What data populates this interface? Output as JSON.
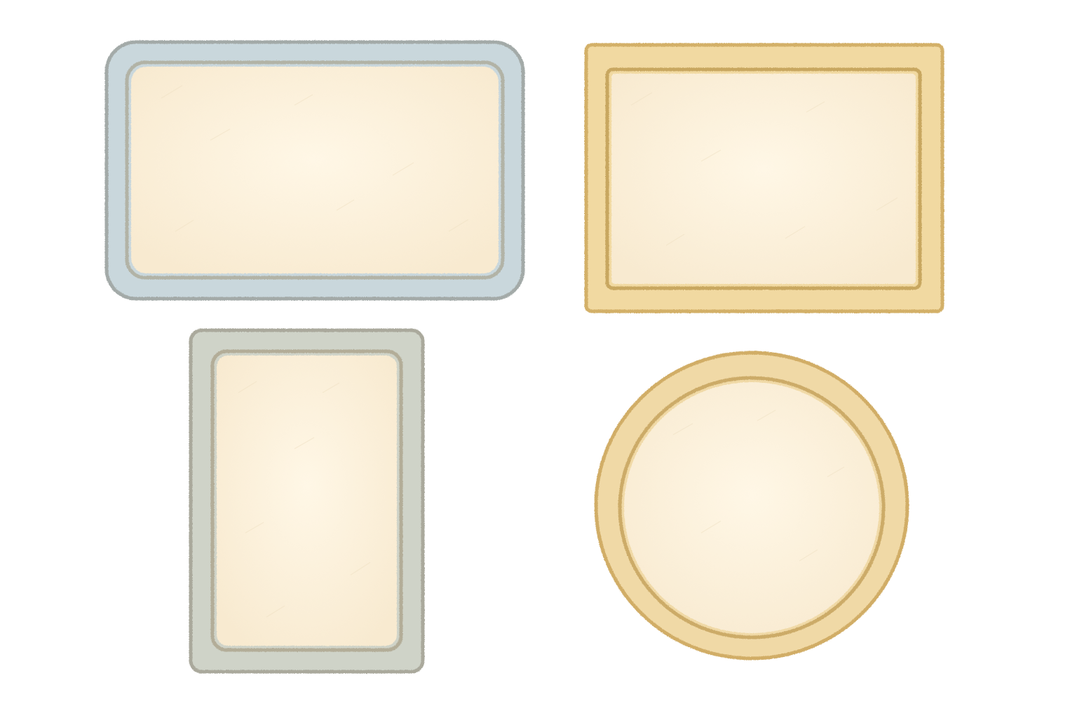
{
  "background_color": "#ffffff",
  "frames": [
    {
      "id": "frame-blue-rounded",
      "shape": "rounded-rectangle",
      "outer_fill": "#c9d7dc",
      "outer_stroke": "#a3aaa8",
      "inner_stroke": "#b2b3a6",
      "panel_fill": "#fdf3df"
    },
    {
      "id": "frame-gold-rectangle",
      "shape": "rectangle",
      "outer_fill": "#f1d9a1",
      "outer_stroke": "#d3b067",
      "inner_stroke": "#c8a760",
      "panel_fill": "#fdf3df"
    },
    {
      "id": "frame-gray-portrait",
      "shape": "rounded-rectangle",
      "outer_fill": "#cfd3c8",
      "outer_stroke": "#aaa99c",
      "inner_stroke": "#b3ad98",
      "panel_fill": "#fdf3df"
    },
    {
      "id": "frame-gold-circle",
      "shape": "circle",
      "outer_fill": "#f0d9a6",
      "outer_stroke": "#d1ad66",
      "inner_stroke": "#ccab68",
      "panel_fill": "#fdf3df"
    }
  ]
}
